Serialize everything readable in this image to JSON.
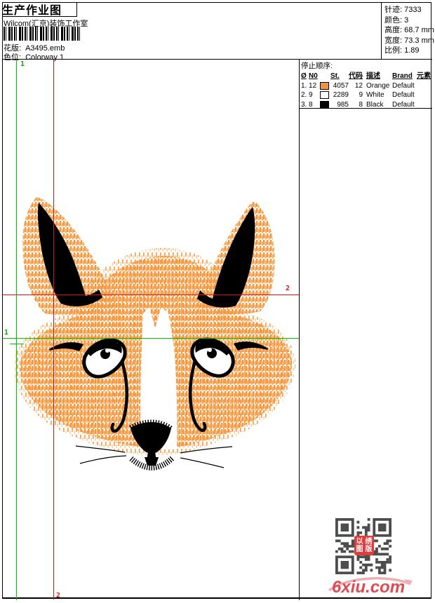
{
  "header": {
    "title": "生产作业图",
    "studio": "Wilcom(汇京)装饰工作室",
    "pattern_label": "花版:",
    "pattern_value": "A3495.emb",
    "colorway_label": "色位:",
    "colorway_value": "Colorway 1"
  },
  "stats": {
    "items": [
      {
        "label": "针迹:",
        "value": "7333"
      },
      {
        "label": "颜色:",
        "value": "3"
      },
      {
        "label": "高度:",
        "value": "68.7 mm"
      },
      {
        "label": "宽度:",
        "value": "73.3 mm"
      },
      {
        "label": "比例:",
        "value": "1.89"
      }
    ]
  },
  "stop_sequence": {
    "title": "停止顺序:",
    "columns": {
      "c0": "Ø",
      "c1": "N0",
      "c2": "",
      "c3": "St.",
      "c4": "代码",
      "c5": "描述",
      "c6": "Brand",
      "c7": "元素"
    },
    "rows": [
      {
        "seq": "1.",
        "needle": "12",
        "color": "#F0953E",
        "st": "4057",
        "code": "12",
        "desc": "Orange",
        "brand": "Default",
        "element": ""
      },
      {
        "seq": "2.",
        "needle": "9",
        "color": "#FFFFFF",
        "st": "2289",
        "code": "9",
        "desc": "White",
        "brand": "Default",
        "element": ""
      },
      {
        "seq": "3.",
        "needle": "8",
        "color": "#000000",
        "st": "985",
        "code": "8",
        "desc": "Black",
        "brand": "Default",
        "element": ""
      }
    ]
  },
  "rulers": {
    "green_top": "1",
    "green_left": "1",
    "red_bottom": "2",
    "red_right": "2",
    "green_color": "#00C400",
    "red_color": "#DE1414"
  },
  "design": {
    "colors": {
      "orange": "#F6963B",
      "black": "#000000",
      "white": "#FFFFFF"
    }
  },
  "watermark": {
    "site": "6xiu.com",
    "stamp": [
      "以",
      "绣",
      "图",
      "版"
    ]
  }
}
